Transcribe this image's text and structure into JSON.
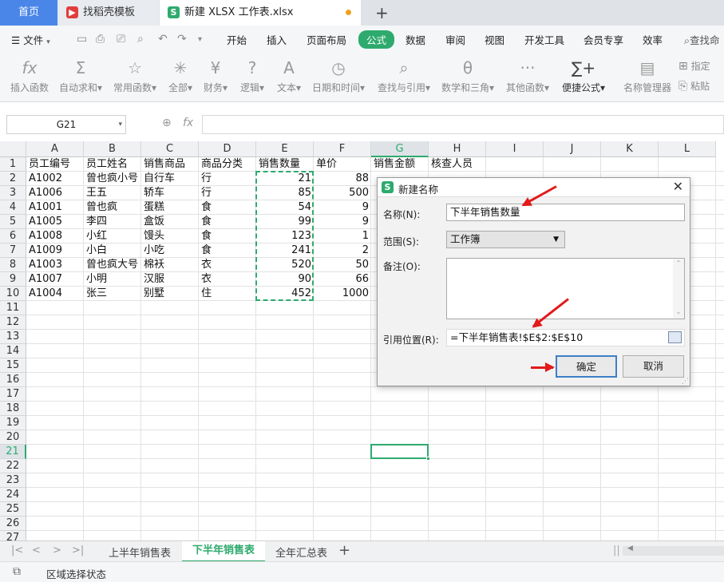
{
  "tabs": {
    "home": "首页",
    "template": "找稻壳模板",
    "file": "新建 XLSX 工作表.xlsx",
    "add": "+"
  },
  "menu": {
    "file": "文件",
    "items": [
      "开始",
      "插入",
      "页面布局",
      "公式",
      "数据",
      "审阅",
      "视图",
      "开发工具",
      "会员专享",
      "效率"
    ],
    "search": "查找命"
  },
  "ribbon": [
    {
      "icon": "fx",
      "label": "插入函数"
    },
    {
      "icon": "Σ",
      "label": "自动求和▾"
    },
    {
      "icon": "☆",
      "label": "常用函数▾"
    },
    {
      "icon": "✳",
      "label": "全部▾"
    },
    {
      "icon": "¥",
      "label": "财务▾"
    },
    {
      "icon": "?",
      "label": "逻辑▾"
    },
    {
      "icon": "A",
      "label": "文本▾"
    },
    {
      "icon": "◷",
      "label": "日期和时间▾"
    },
    {
      "icon": "⌕",
      "label": "查找与引用▾"
    },
    {
      "icon": "θ",
      "label": "数学和三角▾"
    },
    {
      "icon": "···",
      "label": "其他函数▾"
    },
    {
      "icon": "∑+",
      "label": "便捷公式▾"
    },
    {
      "icon": "▤",
      "label": "名称管理器"
    },
    {
      "icon": "⊞",
      "label": "指定"
    },
    {
      "icon": "⎘",
      "label": "粘贴"
    }
  ],
  "formula_bar": {
    "namebox": "G21",
    "fx": "fx"
  },
  "columns": [
    "A",
    "B",
    "C",
    "D",
    "E",
    "F",
    "G",
    "H",
    "I",
    "J",
    "K",
    "L"
  ],
  "rows": [
    "1",
    "2",
    "3",
    "4",
    "5",
    "6",
    "7",
    "8",
    "9",
    "10",
    "11",
    "12",
    "13",
    "14",
    "15",
    "16",
    "17",
    "18",
    "19",
    "20",
    "21",
    "22",
    "23",
    "24",
    "25",
    "26",
    "27"
  ],
  "table": {
    "headers": [
      "员工编号",
      "员工姓名",
      "销售商品",
      "商品分类",
      "销售数量",
      "单价",
      "销售金额",
      "核查人员"
    ],
    "rows": [
      [
        "A1002",
        "曾也疯小号",
        "自行车",
        "行",
        "21",
        "88"
      ],
      [
        "A1006",
        "王五",
        "轿车",
        "行",
        "85",
        "500"
      ],
      [
        "A1001",
        "曾也疯",
        "蛋糕",
        "食",
        "54",
        "9"
      ],
      [
        "A1005",
        "李四",
        "盒饭",
        "食",
        "99",
        "9"
      ],
      [
        "A1008",
        "小红",
        "馒头",
        "食",
        "123",
        "1"
      ],
      [
        "A1009",
        "小白",
        "小吃",
        "食",
        "241",
        "2"
      ],
      [
        "A1003",
        "曾也疯大号",
        "棉袄",
        "衣",
        "520",
        "50"
      ],
      [
        "A1007",
        "小明",
        "汉服",
        "衣",
        "90",
        "66"
      ],
      [
        "A1004",
        "张三",
        "别墅",
        "住",
        "452",
        "1000"
      ]
    ]
  },
  "dialog": {
    "title": "新建名称",
    "name_label": "名称(N):",
    "name_value": "下半年销售数量",
    "scope_label": "范围(S):",
    "scope_value": "工作簿",
    "note_label": "备注(O):",
    "ref_label": "引用位置(R):",
    "ref_value": "=下半年销售表!$E$2:$E$10",
    "ok": "确定",
    "cancel": "取消"
  },
  "sheets": [
    "上半年销售表",
    "下半年销售表",
    "全年汇总表"
  ],
  "active_sheet": "下半年销售表",
  "status": "区域选择状态",
  "colors": {
    "accent": "#2eaa6e",
    "home_tab": "#4a86e8",
    "arrow": "#e21a1a"
  }
}
